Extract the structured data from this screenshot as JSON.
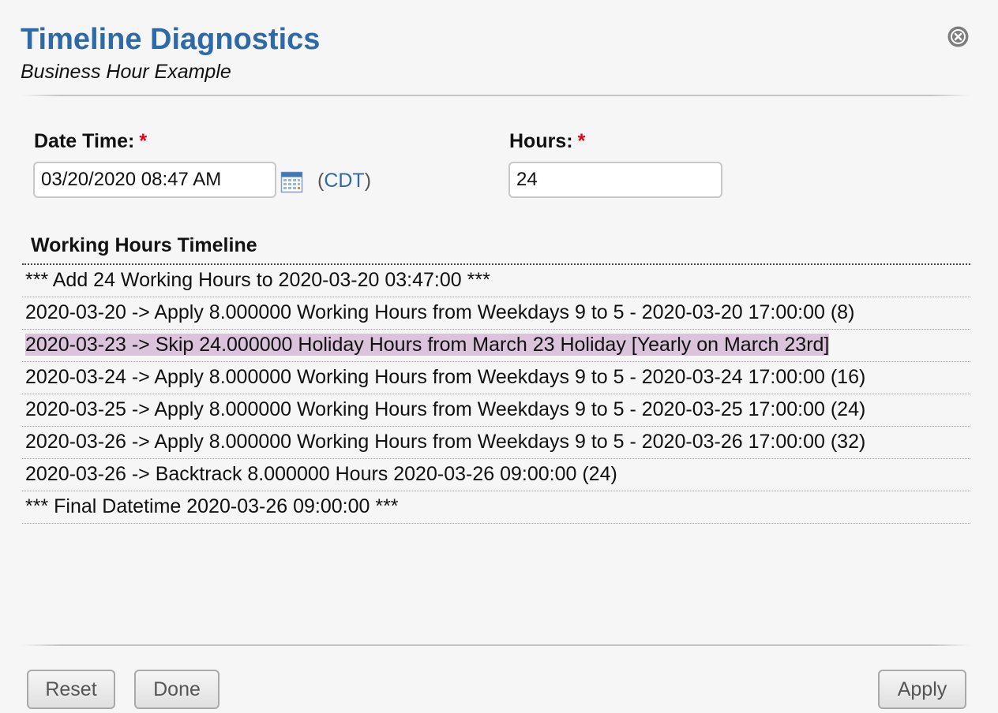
{
  "dialog": {
    "title": "Timeline Diagnostics",
    "subtitle": "Business Hour Example",
    "close_icon": "close-circle-icon"
  },
  "form": {
    "datetime": {
      "label": "Date Time:",
      "required_mark": "*",
      "value": "03/20/2020 08:47 AM",
      "calendar_icon": "calendar-icon",
      "tz_open": "(",
      "tz": "CDT",
      "tz_close": ")"
    },
    "hours": {
      "label": "Hours:",
      "required_mark": "*",
      "value": "24"
    }
  },
  "timeline": {
    "title": "Working Hours Timeline",
    "rows": [
      "*** Add 24 Working Hours to 2020-03-20 03:47:00 ***",
      "2020-03-20 -> Apply 8.000000 Working Hours from Weekdays 9 to 5 - 2020-03-20 17:00:00 (8)",
      "2020-03-23 -> Skip 24.000000 Holiday Hours from March 23 Holiday [Yearly on March 23rd]",
      "2020-03-24 -> Apply 8.000000 Working Hours from Weekdays 9 to 5 - 2020-03-24 17:00:00 (16)",
      "2020-03-25 -> Apply 8.000000 Working Hours from Weekdays 9 to 5 - 2020-03-25 17:00:00 (24)",
      "2020-03-26 -> Apply 8.000000 Working Hours from Weekdays 9 to 5 - 2020-03-26 17:00:00 (32)",
      "2020-03-26 -> Backtrack 8.000000 Hours 2020-03-26 09:00:00 (24)",
      "*** Final Datetime 2020-03-26 09:00:00 ***"
    ],
    "highlight_color": "#dcc3dc"
  },
  "buttons": {
    "reset": "Reset",
    "done": "Done",
    "apply": "Apply"
  },
  "colors": {
    "accent": "#2e6aa8",
    "required": "#e0001a"
  }
}
